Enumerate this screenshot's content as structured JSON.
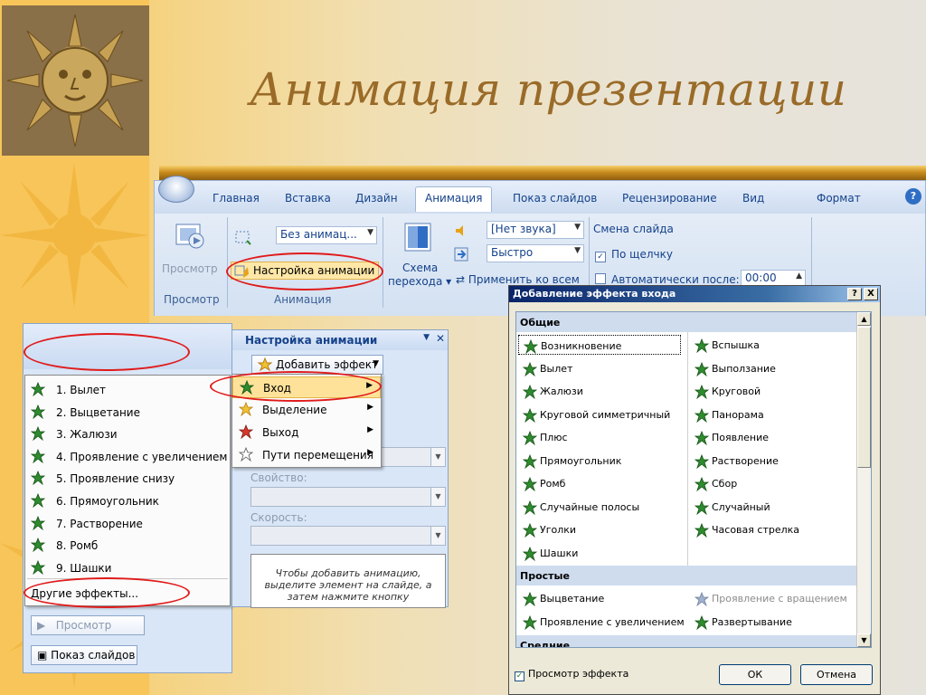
{
  "slide": {
    "title": "Анимация презентации"
  },
  "ribbon": {
    "tabs": [
      "Главная",
      "Вставка",
      "Дизайн",
      "Анимация",
      "Показ слайдов",
      "Рецензирование",
      "Вид",
      "Формат"
    ],
    "active_tab": "Анимация",
    "preview_btn": "Просмотр",
    "preview_group": "Просмотр",
    "no_anim_combo": "Без анимац...",
    "custom_anim_btn": "Настройка анимации",
    "anim_group": "Анимация",
    "scheme_label_1": "Схема",
    "scheme_label_2": "перехода",
    "sound_combo": "[Нет звука]",
    "speed_combo": "Быстро",
    "apply_all": "Применить ко всем",
    "slide_change": "Смена слайда",
    "on_click": "По щелчку",
    "auto_after": "Автоматически после:",
    "auto_time": "00:00"
  },
  "task_pane": {
    "title": "Настройка анимации",
    "add_effect": "Добавить эффект",
    "property_label": "Свойство:",
    "speed_label": "Скорость:",
    "note": "Чтобы добавить анимацию, выделите элемент на слайде, а затем нажмите кнопку"
  },
  "submenu": [
    {
      "label": "Вход",
      "icon": "entrance-star-icon"
    },
    {
      "label": "Выделение",
      "icon": "emphasis-star-icon"
    },
    {
      "label": "Выход",
      "icon": "exit-star-icon"
    },
    {
      "label": "Пути перемещения",
      "icon": "motion-path-star-icon"
    }
  ],
  "effect_list": [
    "1. Вылет",
    "2. Выцветание",
    "3. Жалюзи",
    "4. Проявление с увеличением",
    "5. Проявление снизу",
    "6. Прямоугольник",
    "7. Растворение",
    "8. Ромб",
    "9. Шашки"
  ],
  "more_effects": "Другие эффекты...",
  "left_pane": {
    "preview": "Просмотр",
    "slideshow": "Показ слайдов"
  },
  "dialog": {
    "title": "Добавление эффекта входа",
    "title_buttons": [
      "?",
      "X"
    ],
    "cat_general": "Общие",
    "general_left": [
      "Возникновение",
      "Вылет",
      "Жалюзи",
      "Круговой симметричный",
      "Плюс",
      "Прямоугольник",
      "Ромб",
      "Случайные полосы",
      "Уголки",
      "Шашки"
    ],
    "general_right": [
      "Вспышка",
      "Выползание",
      "Круговой",
      "Панорама",
      "Появление",
      "Растворение",
      "Сбор",
      "Случайный",
      "Часовая стрелка"
    ],
    "cat_simple": "Простые",
    "simple_left": [
      "Выцветание",
      "Проявление с увеличением"
    ],
    "simple_right": [
      "Проявление с вращением",
      "Развертывание"
    ],
    "cat_medium": "Средние",
    "preview_check": "Просмотр эффекта",
    "ok": "ОК",
    "cancel": "Отмена"
  },
  "colors": {
    "title": "#9a6b28",
    "accent_gold": "#c98d1c",
    "highlight_oval": "#e01b1b",
    "star_green": "#2e8b2e"
  }
}
